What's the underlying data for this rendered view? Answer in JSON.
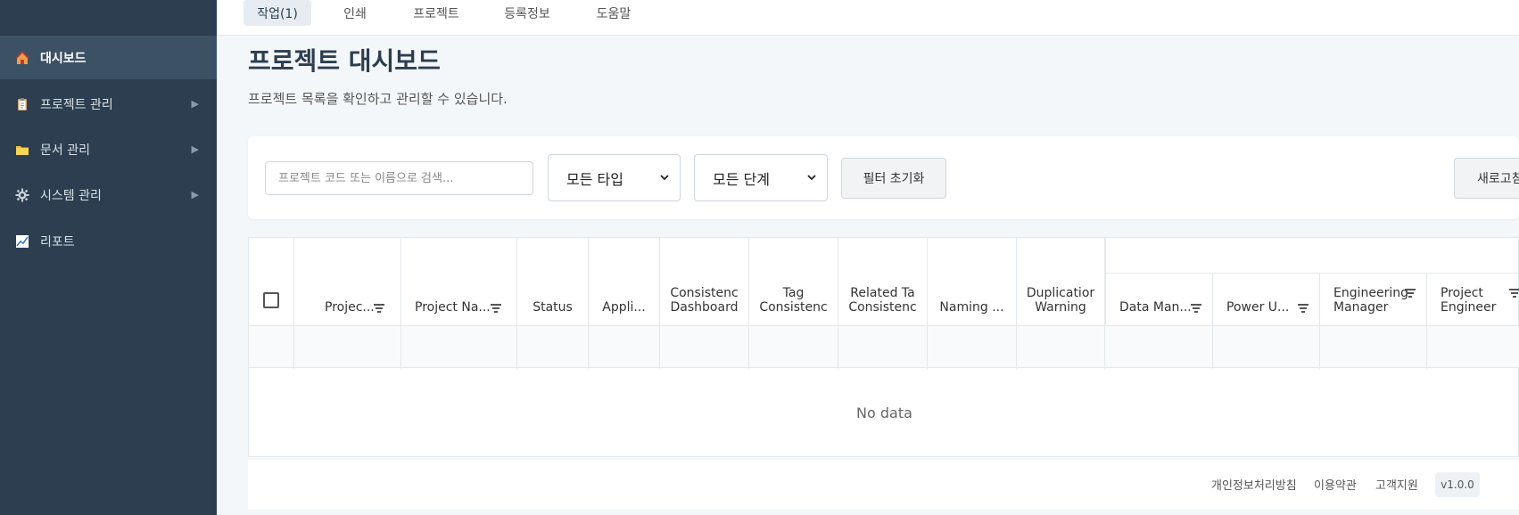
{
  "sidebar": {
    "items": [
      {
        "label": "대시보드",
        "icon": "house-icon"
      },
      {
        "label": "프로젝트 관리",
        "icon": "clipboard-icon"
      },
      {
        "label": "문서 관리",
        "icon": "folder-icon"
      },
      {
        "label": "시스템 관리",
        "icon": "gear-icon"
      },
      {
        "label": "리포트",
        "icon": "chart-icon"
      }
    ],
    "arrow": "▶"
  },
  "tabs": [
    {
      "label": "작업(1)"
    },
    {
      "label": "인쇄"
    },
    {
      "label": "프로젝트"
    },
    {
      "label": "등록정보"
    },
    {
      "label": "도움말"
    }
  ],
  "page": {
    "title": "프로젝트 대시보드",
    "subtitle": "프로젝트 목록을 확인하고 관리할 수 있습니다."
  },
  "filters": {
    "search_placeholder": "프로젝트 코드 또는 이름으로 검색...",
    "type_select": "모든 타입",
    "stage_select": "모든 단계",
    "reset_button": "필터 초기화",
    "refresh_button": "새로고침"
  },
  "table": {
    "columns": [
      {
        "l1": "Projec...",
        "l2": ""
      },
      {
        "l1": "Project Na...",
        "l2": ""
      },
      {
        "l1": "Status",
        "l2": ""
      },
      {
        "l1": "Appli...",
        "l2": ""
      },
      {
        "l1": "Consistenc",
        "l2": "Dashboard"
      },
      {
        "l1": "Tag",
        "l2": "Consistenc"
      },
      {
        "l1": "Related Ta",
        "l2": "Consistenc"
      },
      {
        "l1": "Naming ...",
        "l2": ""
      },
      {
        "l1": "Duplicatior",
        "l2": "Warning"
      },
      {
        "l1": "Data Man...",
        "l2": ""
      },
      {
        "l1": "Power U...",
        "l2": ""
      },
      {
        "l1": "Engineering",
        "l2": "Manager"
      },
      {
        "l1": "Project",
        "l2": "Engineer"
      }
    ],
    "empty_text": "No data"
  },
  "footer": {
    "privacy": "개인정보처리방침",
    "terms": "이용약관",
    "support": "고객지원",
    "version": "v1.0.0"
  },
  "colors": {
    "sidebar_bg": "#2c3e50",
    "sidebar_active": "#3d5165",
    "page_bg": "#f4f7f9"
  }
}
